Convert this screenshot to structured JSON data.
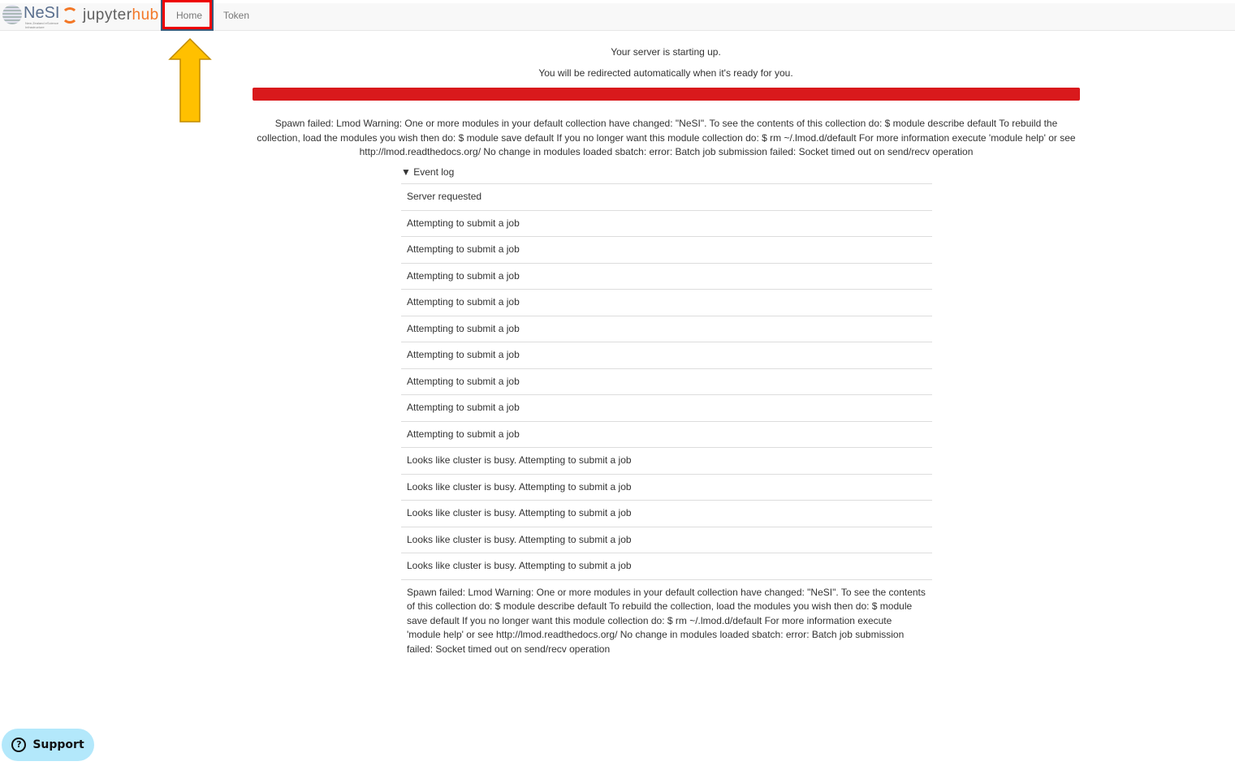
{
  "nav": {
    "brand_nesi": "NeSI",
    "brand_nesi_sub": "New Zealand eScience Infrastructure",
    "brand_jupyter": "jupyter",
    "brand_hub": "hub",
    "links": [
      {
        "label": "Home"
      },
      {
        "label": "Token"
      }
    ]
  },
  "status": {
    "starting": "Your server is starting up.",
    "redirect": "You will be redirected automatically when it's ready for you.",
    "progress_percent": 100,
    "progress_color": "#d9191c"
  },
  "error": "Spawn failed: Lmod Warning: One or more modules in your default collection have changed: \"NeSI\". To see the contents of this collection do: $ module describe default To rebuild the collection, load the modules you wish then do: $ module save default If you no longer want this module collection do: $ rm ~/.lmod.d/default For more information execute 'module help' or see http://lmod.readthedocs.org/ No change in modules loaded sbatch: error: Batch job submission failed: Socket timed out on send/recv operation",
  "event_log": {
    "label": "Event log",
    "events": [
      "Server requested",
      "Attempting to submit a job",
      "Attempting to submit a job",
      "Attempting to submit a job",
      "Attempting to submit a job",
      "Attempting to submit a job",
      "Attempting to submit a job",
      "Attempting to submit a job",
      "Attempting to submit a job",
      "Attempting to submit a job",
      "Looks like cluster is busy. Attempting to submit a job",
      "Looks like cluster is busy. Attempting to submit a job",
      "Looks like cluster is busy. Attempting to submit a job",
      "Looks like cluster is busy. Attempting to submit a job",
      "Looks like cluster is busy. Attempting to submit a job",
      "Spawn failed: Lmod Warning: One or more modules in your default collection have changed: \"NeSI\". To see the contents of this collection do: $ module describe default To rebuild the collection, load the modules you wish then do: $ module save default If you no longer want this module collection do: $ rm ~/.lmod.d/default For more information execute 'module help' or see http://lmod.readthedocs.org/ No change in modules loaded sbatch: error: Batch job submission failed: Socket timed out on send/recv operation"
    ]
  },
  "support": {
    "label": "Support",
    "icon": "question-circle-icon"
  },
  "annotation": {
    "highlight_color": "#e00000",
    "arrow_color": "#ffc000"
  }
}
